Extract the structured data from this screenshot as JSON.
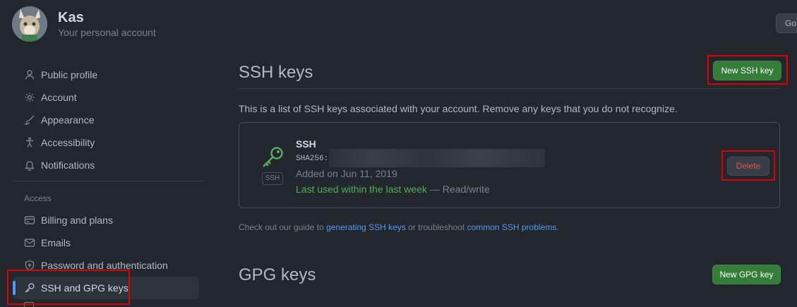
{
  "account": {
    "name": "Kas",
    "subtitle": "Your personal account",
    "goto_button": "Go to your personal profile"
  },
  "sidebar": {
    "items": [
      {
        "label": "Public profile",
        "icon": "person-icon"
      },
      {
        "label": "Account",
        "icon": "gear-icon"
      },
      {
        "label": "Appearance",
        "icon": "paintbrush-icon"
      },
      {
        "label": "Accessibility",
        "icon": "accessibility-icon"
      },
      {
        "label": "Notifications",
        "icon": "bell-icon"
      }
    ],
    "access_label": "Access",
    "access_items": [
      {
        "label": "Billing and plans",
        "icon": "credit-card-icon"
      },
      {
        "label": "Emails",
        "icon": "mail-icon"
      },
      {
        "label": "Password and authentication",
        "icon": "shield-lock-icon"
      },
      {
        "label": "SSH and GPG keys",
        "icon": "key-icon",
        "active": true
      }
    ]
  },
  "ssh": {
    "heading": "SSH keys",
    "new_button": "New SSH key",
    "description": "This is a list of SSH keys associated with your account. Remove any keys that you do not recognize.",
    "key": {
      "title": "SSH",
      "fingerprint_label": "SHA256:",
      "added": "Added on Jun 11, 2019",
      "last_used": "Last used within the last week",
      "access": " — Read/write",
      "badge": "SSH",
      "delete_button": "Delete"
    },
    "guide": {
      "prefix": "Check out our guide to ",
      "link1": "generating SSH keys",
      "middle": " or troubleshoot ",
      "link2": "common SSH problems",
      "suffix": "."
    }
  },
  "gpg": {
    "heading": "GPG keys",
    "new_button": "New GPG key"
  },
  "colors": {
    "background": "#22272e",
    "accent_green": "#347d39",
    "link_blue": "#539bf5",
    "danger_red": "#e5534b",
    "highlight_box": "#e00000"
  }
}
